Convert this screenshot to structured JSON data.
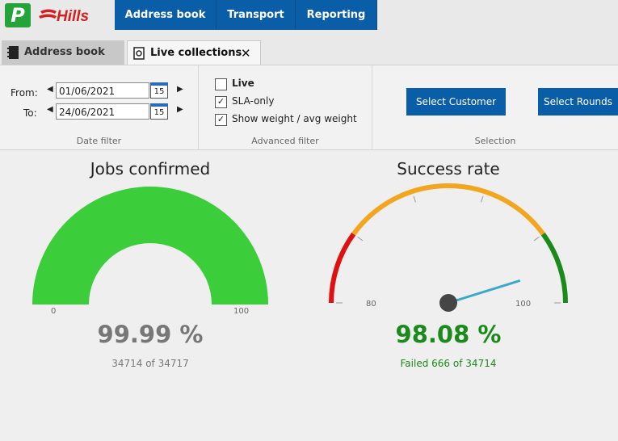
{
  "app": {
    "logo_letter": "P",
    "brand": "Hills"
  },
  "nav": {
    "tabs": [
      "Address book",
      "Transport",
      "Reporting"
    ]
  },
  "doc_tabs": {
    "inactive": "Address book",
    "active": "Live collections",
    "close_glyph": "✕"
  },
  "date_filter": {
    "from_label": "From:",
    "from_value": "01/06/2021",
    "to_label": "To:",
    "to_value": "24/06/2021",
    "calendar_day": "15",
    "group_label": "Date filter"
  },
  "advanced_filter": {
    "live_label": "Live",
    "live_checked": false,
    "sla_label": "SLA-only",
    "sla_checked": true,
    "weight_label": "Show weight / avg weight",
    "weight_checked": true,
    "group_label": "Advanced filter",
    "check_glyph": "✓"
  },
  "selection": {
    "customer_button": "Select Customer",
    "rounds_button": "Select Rounds",
    "group_label": "Selection"
  },
  "jobs_gauge": {
    "title": "Jobs confirmed",
    "min_label": "0",
    "max_label": "100",
    "value_text": "99.99 %",
    "count": "34714",
    "of_label": "of",
    "total": "34717",
    "value": 99.99,
    "color": "#3ccd3a"
  },
  "success_gauge": {
    "title": "Success rate",
    "min_label": "80",
    "max_label": "100",
    "value_text": "98.08 %",
    "failed_label": "Failed",
    "failed": "666",
    "of_label": "of",
    "total": "34714",
    "value": 98.08,
    "range": [
      80,
      100
    ],
    "bands": [
      {
        "from": 80,
        "to": 84,
        "color": "#e01010"
      },
      {
        "from": 84,
        "to": 96,
        "color": "#f2a51f"
      },
      {
        "from": 96,
        "to": 100,
        "color": "#1a8a1a"
      }
    ],
    "needle_color": "#3aa8c8",
    "value_color": "#1a8a1a"
  }
}
